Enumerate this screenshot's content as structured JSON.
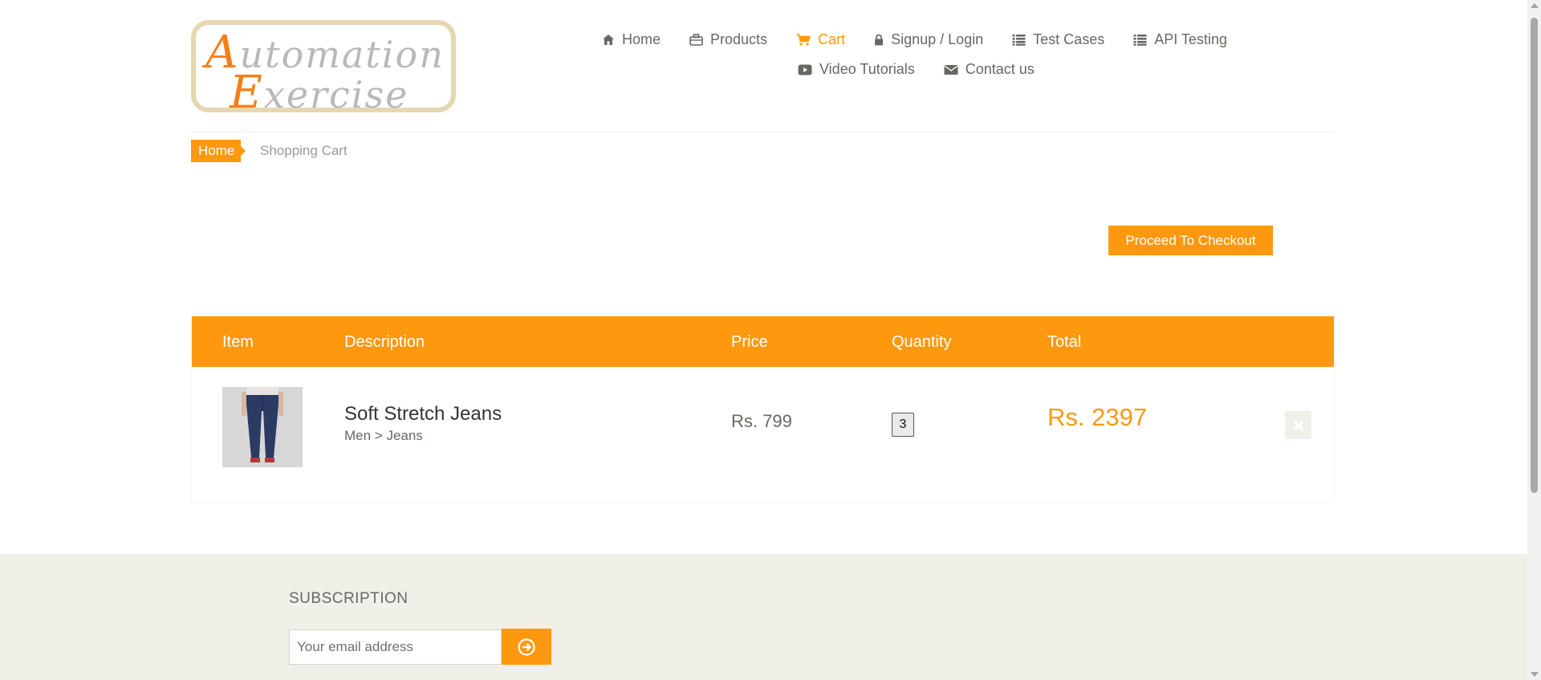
{
  "logo": {
    "line1_cap": "A",
    "line1_rest": "utomation",
    "line2_cap": "E",
    "line2_rest": "xercise"
  },
  "nav": {
    "row1": [
      {
        "label": "Home",
        "icon": "home-icon",
        "active": false
      },
      {
        "label": "Products",
        "icon": "briefcase-icon",
        "active": false
      },
      {
        "label": "Cart",
        "icon": "shopping-cart-icon",
        "active": true
      },
      {
        "label": "Signup / Login",
        "icon": "lock-icon",
        "active": false
      },
      {
        "label": "Test Cases",
        "icon": "list-icon",
        "active": false
      },
      {
        "label": "API Testing",
        "icon": "list-icon",
        "active": false
      }
    ],
    "row2": [
      {
        "label": "Video Tutorials",
        "icon": "youtube-play-icon",
        "active": false
      },
      {
        "label": "Contact us",
        "icon": "envelope-icon",
        "active": false
      }
    ]
  },
  "breadcrumb": {
    "home": "Home",
    "current": "Shopping Cart"
  },
  "checkout_button": "Proceed To Checkout",
  "cart": {
    "headers": {
      "item": "Item",
      "description": "Description",
      "price": "Price",
      "quantity": "Quantity",
      "total": "Total"
    },
    "rows": [
      {
        "name": "Soft Stretch Jeans",
        "category": "Men > Jeans",
        "price": "Rs. 799",
        "quantity": "3",
        "total": "Rs. 2397"
      }
    ]
  },
  "subscription": {
    "title": "SUBSCRIPTION",
    "placeholder": "Your email address"
  },
  "colors": {
    "accent": "#fe980f",
    "text": "#696763",
    "footer_bg": "#f0f0e9"
  }
}
